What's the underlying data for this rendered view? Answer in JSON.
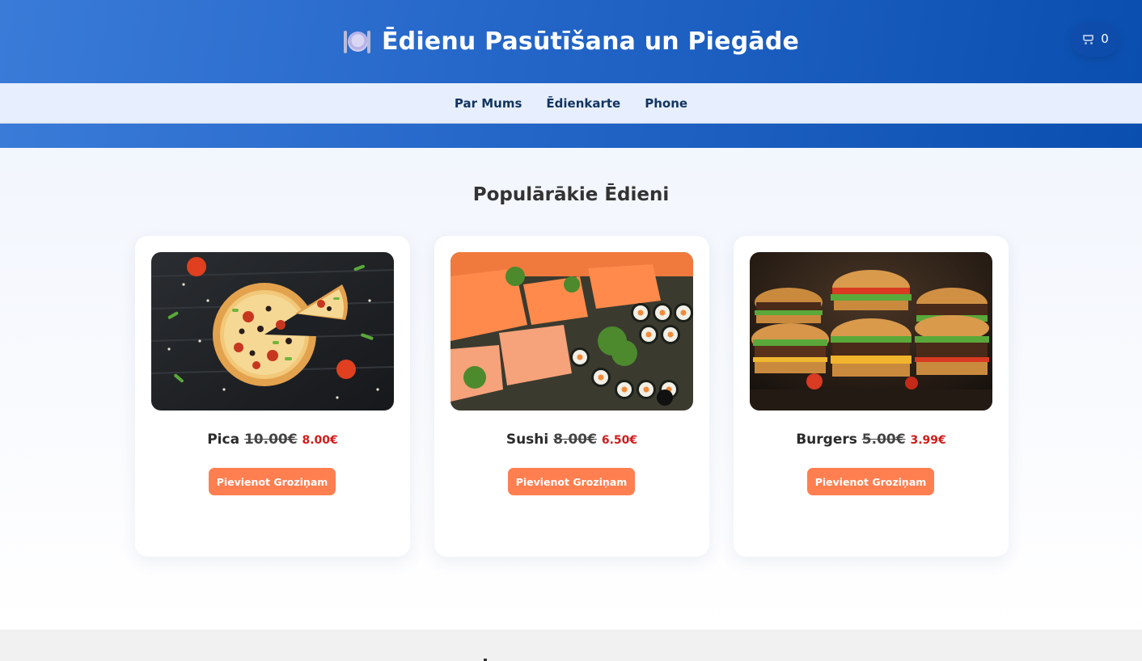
{
  "header": {
    "icon": "plate-with-cutlery-icon",
    "title": "Ēdienu Pasūtīšana un Piegāde",
    "cart": {
      "icon": "shopping-cart-icon",
      "count": "0"
    },
    "gradient_colors": [
      "#3a7bd8",
      "#0a4fb0"
    ]
  },
  "nav": {
    "items": [
      {
        "label": "Par Mums"
      },
      {
        "label": "Ēdienkarte"
      },
      {
        "label": "Phone"
      }
    ]
  },
  "main": {
    "section_title": "Populārākie Ēdieni",
    "products": [
      {
        "name": "Pica",
        "old_price": "10.00€",
        "new_price": "8.00€",
        "button": "Pievienot Groziņam",
        "image": "pizza-photo"
      },
      {
        "name": "Sushi",
        "old_price": "8.00€",
        "new_price": "6.50€",
        "button": "Pievienot Groziņam",
        "image": "sushi-photo"
      },
      {
        "name": "Burgers",
        "old_price": "5.00€",
        "new_price": "3.99€",
        "button": "Pievienot Groziņam",
        "image": "burgers-photo"
      }
    ]
  },
  "colors": {
    "accent_button": "#ff7f50",
    "sale_price": "#d21b1b",
    "nav_background": "#e7efff",
    "nav_text": "#12345f"
  }
}
